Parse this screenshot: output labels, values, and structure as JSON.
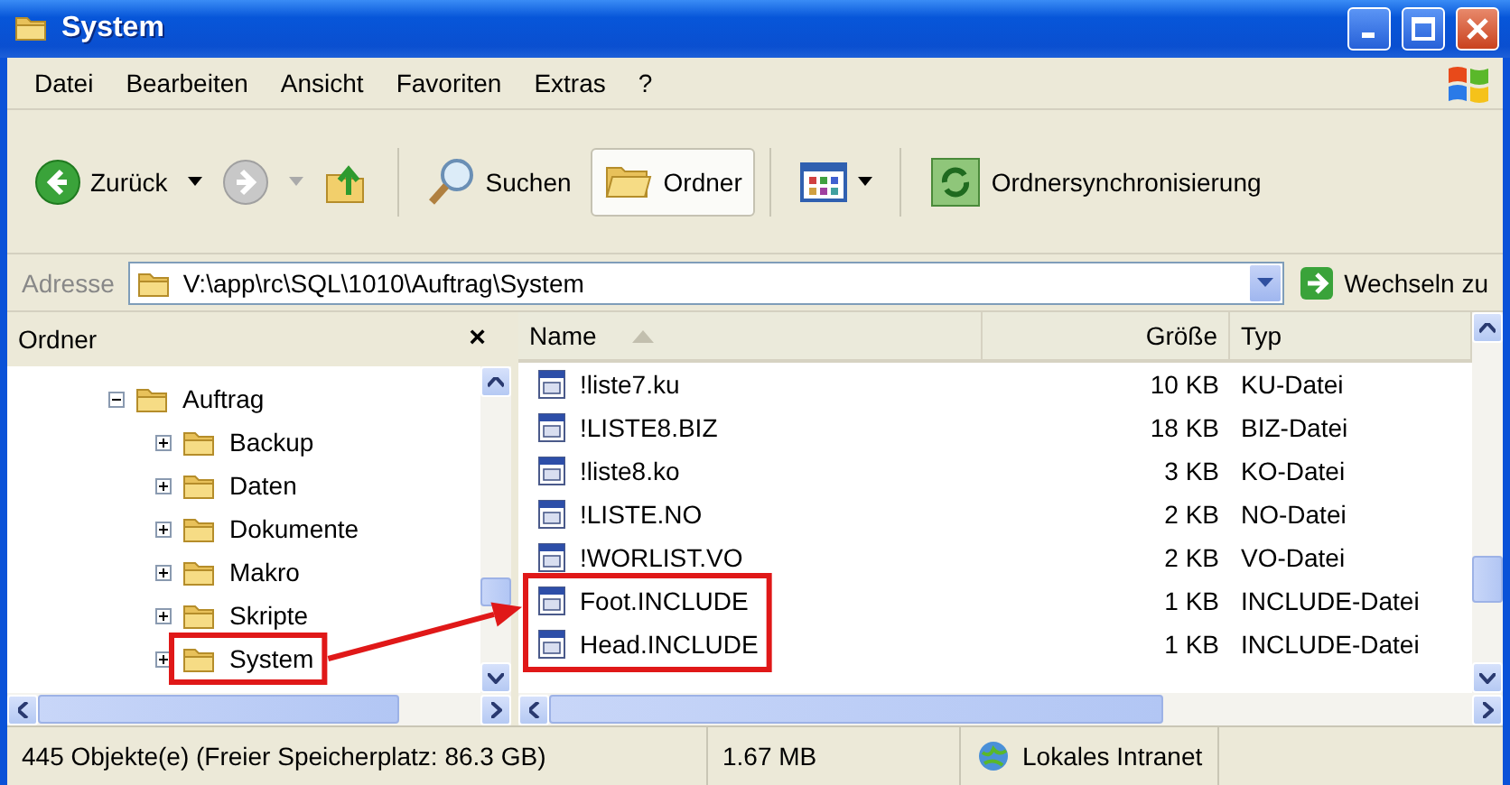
{
  "window": {
    "title": "System"
  },
  "menu": [
    {
      "label": "Datei"
    },
    {
      "label": "Bearbeiten"
    },
    {
      "label": "Ansicht"
    },
    {
      "label": "Favoriten"
    },
    {
      "label": "Extras"
    },
    {
      "label": "?"
    }
  ],
  "toolbar": [
    {
      "kind": "back",
      "label": "Zurück",
      "disabled": false
    },
    {
      "kind": "forward",
      "disabled": true
    },
    {
      "kind": "up"
    },
    {
      "kind": "separator"
    },
    {
      "kind": "search",
      "label": "Suchen",
      "selected": false
    },
    {
      "kind": "folders",
      "label": "Ordner",
      "selected": true
    },
    {
      "kind": "separator"
    },
    {
      "kind": "views"
    },
    {
      "kind": "separator"
    },
    {
      "kind": "sync",
      "label": "Ordnersynchronisierung",
      "selected": false
    }
  ],
  "address": {
    "label": "Adresse",
    "value": "V:\\app\\rc\\SQL\\1010\\Auftrag\\System",
    "go_label": "Wechseln zu"
  },
  "folders": {
    "title": "Ordner",
    "close": "×",
    "tree": [
      {
        "label": "Auftrag",
        "expanded": true,
        "highlighted": false,
        "children": [
          {
            "label": "Backup",
            "expanded": false,
            "highlighted": false
          },
          {
            "label": "Daten",
            "expanded": false,
            "highlighted": false
          },
          {
            "label": "Dokumente",
            "expanded": false,
            "highlighted": false
          },
          {
            "label": "Makro",
            "expanded": false,
            "highlighted": false
          },
          {
            "label": "Skripte",
            "expanded": false,
            "highlighted": false
          },
          {
            "label": "System",
            "expanded": false,
            "highlighted": true
          }
        ]
      }
    ]
  },
  "files": {
    "columns": [
      {
        "label": "Name",
        "sorted": true
      },
      {
        "label": "Größe",
        "sorted": false
      },
      {
        "label": "Typ",
        "sorted": false
      }
    ],
    "rows": [
      {
        "name": "!liste7.ku",
        "size": "10 KB",
        "type": "KU-Datei",
        "highlighted": false
      },
      {
        "name": "!LISTE8.BIZ",
        "size": "18 KB",
        "type": "BIZ-Datei",
        "highlighted": false
      },
      {
        "name": "!liste8.ko",
        "size": "3 KB",
        "type": "KO-Datei",
        "highlighted": false
      },
      {
        "name": "!LISTE.NO",
        "size": "2 KB",
        "type": "NO-Datei",
        "highlighted": false
      },
      {
        "name": "!WORLIST.VO",
        "size": "2 KB",
        "type": "VO-Datei",
        "highlighted": false
      },
      {
        "name": "Foot.INCLUDE",
        "size": "1 KB",
        "type": "INCLUDE-Datei",
        "highlighted": true
      },
      {
        "name": "Head.INCLUDE",
        "size": "1 KB",
        "type": "INCLUDE-Datei",
        "highlighted": true
      }
    ]
  },
  "status_bar": {
    "objects": "445 Objekte(e) (Freier Speicherplatz: 86.3 GB)",
    "size": "1.67 MB",
    "zone": "Lokales Intranet"
  }
}
